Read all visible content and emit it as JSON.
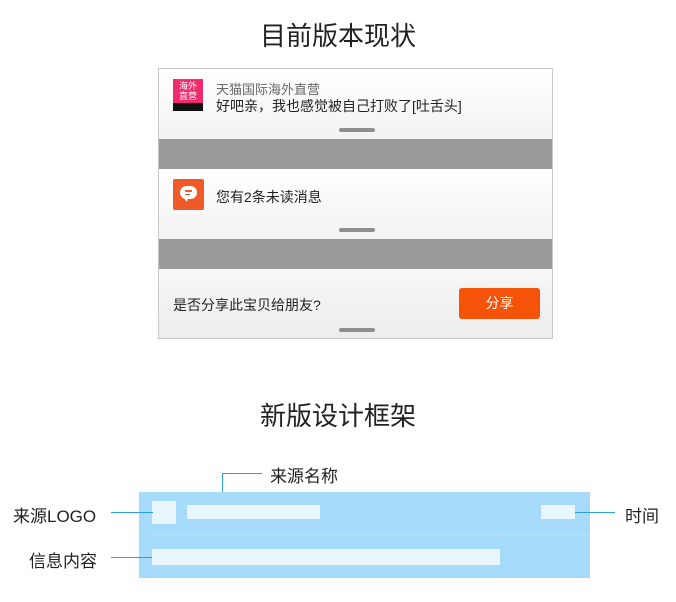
{
  "current": {
    "title": "目前版本现状",
    "notification1": {
      "logo_text_line1": "海外",
      "logo_text_line2": "直营",
      "source": "天猫国际海外直营",
      "message": "好吧亲，我也感觉被自己打败了[吐舌头]"
    },
    "notification2": {
      "message": "您有2条未读消息"
    },
    "notification3": {
      "question": "是否分享此宝贝给朋友?",
      "button": "分享"
    }
  },
  "framework": {
    "title": "新版设计框架",
    "labels": {
      "source_name": "来源名称",
      "source_logo": "来源LOGO",
      "time": "时间",
      "message_content": "信息内容"
    }
  },
  "colors": {
    "frame_blue": "#a6dbfb",
    "leader_line": "#2ba0dc",
    "share_orange": "#f5520a",
    "tmall_pink": "#f12b6e"
  }
}
